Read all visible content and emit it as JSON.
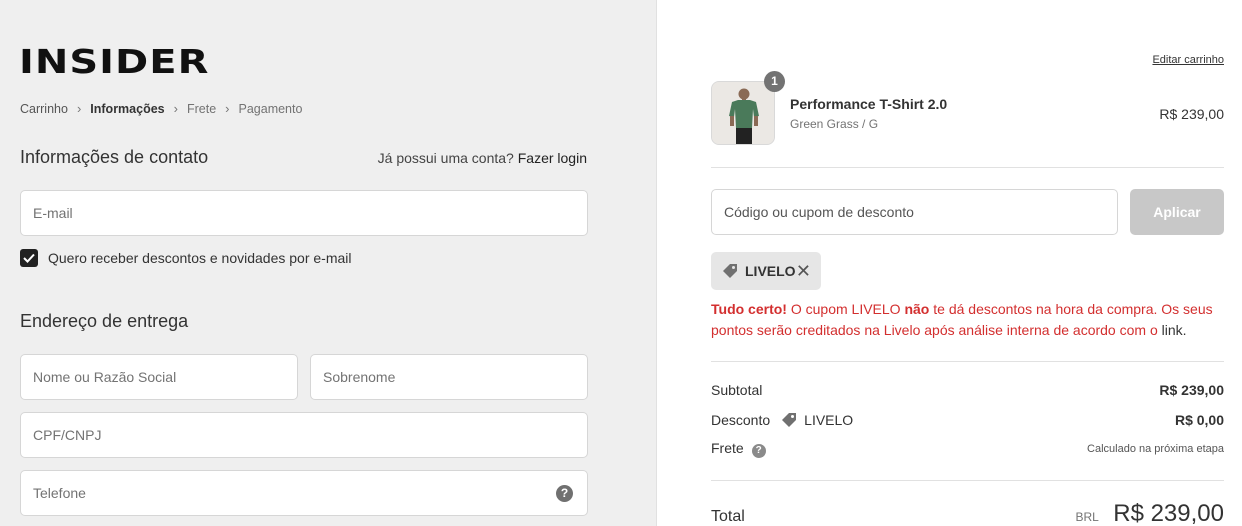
{
  "brand": {
    "logo_text": "INSIDER"
  },
  "breadcrumb": {
    "items": [
      "Carrinho",
      "Informações",
      "Frete",
      "Pagamento"
    ],
    "sep": "›"
  },
  "contact": {
    "title": "Informações de contato",
    "has_account": "Já possui uma conta?",
    "login_link": "Fazer login",
    "email_placeholder": "E-mail",
    "newsletter_label": "Quero receber descontos e novidades por e-mail",
    "newsletter_checked": true
  },
  "shipping": {
    "title": "Endereço de entrega",
    "name_placeholder": "Nome ou Razão Social",
    "surname_placeholder": "Sobrenome",
    "doc_placeholder": "CPF/CNPJ",
    "phone_placeholder": "Telefone",
    "help_glyph": "?"
  },
  "cart": {
    "edit_link": "Editar carrinho",
    "item": {
      "name": "Performance T-Shirt 2.0",
      "variant": "Green Grass / G",
      "price": "R$ 239,00",
      "quantity": "1",
      "shirt_color": "#4a7a5a"
    }
  },
  "discount": {
    "placeholder": "Código ou cupom de desconto",
    "apply_label": "Aplicar",
    "applied_code": "LIVELO",
    "close_glyph": "✕",
    "notice": {
      "part1": "Tudo certo!",
      "part2": " O cupom LIVELO ",
      "part3": "não",
      "part4": " te dá descontos na hora da compra. Os seus pontos serão creditados na Livelo após análise interna de acordo com o ",
      "link": "link",
      "end": "."
    }
  },
  "summary": {
    "subtotal_label": "Subtotal",
    "subtotal_value": "R$ 239,00",
    "discount_label": "Desconto",
    "discount_code": "LIVELO",
    "discount_value": "R$ 0,00",
    "shipping_label": "Frete",
    "shipping_help": "?",
    "shipping_value": "Calculado na próxima etapa",
    "total_label": "Total",
    "currency": "BRL",
    "total_value": "R$ 239,00"
  },
  "colors": {
    "left_bg": "#efefef",
    "notice_red": "#d32f2f",
    "apply_disabled": "#c8c8c8"
  }
}
